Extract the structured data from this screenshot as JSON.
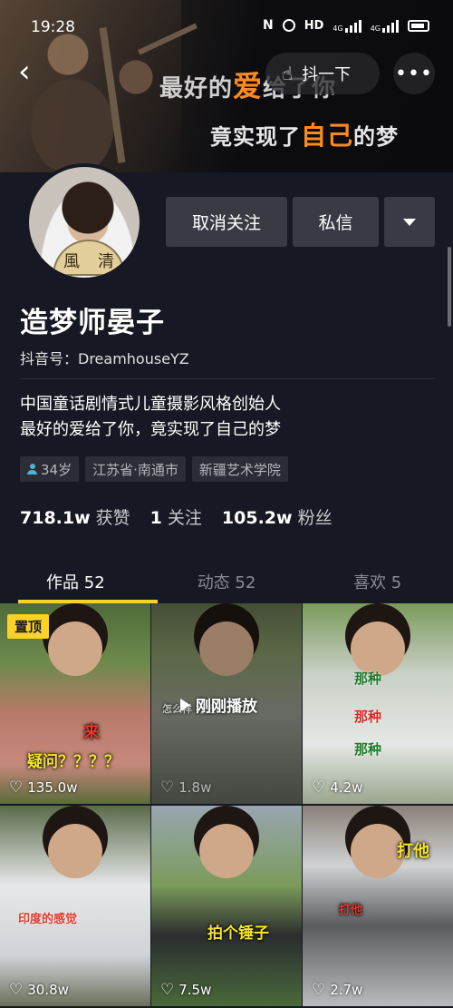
{
  "status_bar": {
    "time": "19:28",
    "icons": [
      "nfc-icon",
      "alarm-icon",
      "hd-icon",
      "signal-4g-icon",
      "signal-4g-icon",
      "battery-icon"
    ],
    "hd": "HD",
    "net1": "4G",
    "net2": "4G"
  },
  "cover": {
    "line1_pre": "最好的",
    "line1_hl": "爱",
    "line1_post": "给了你",
    "line2_pre": "竟实现了",
    "line2_hl": "自己",
    "line2_post": "的梦",
    "highlight_color": "#ff8a1f"
  },
  "header": {
    "shake_label": "抖一下",
    "more_label": "•••"
  },
  "profile": {
    "avatar_text": [
      "風",
      "清"
    ],
    "unfollow_label": "取消关注",
    "message_label": "私信",
    "name": "造梦师晏子",
    "douyin_id": "抖音号：DreamhouseYZ",
    "bio_line1": "中国童话剧情式儿童摄影风格创始人",
    "bio_line2": "最好的爱给了你，竟实现了自己的梦",
    "tags": {
      "age": "34岁",
      "location": "江苏省·南通市",
      "school": "新疆艺术学院"
    },
    "stats": {
      "likes_num": "718.1w",
      "likes_label": "获赞",
      "following_num": "1",
      "following_label": "关注",
      "fans_num": "105.2w",
      "fans_label": "粉丝"
    }
  },
  "tabs": {
    "works": "作品 52",
    "dynamics": "动态 52",
    "likes": "喜欢 5"
  },
  "videos": [
    {
      "pinned": "置顶",
      "likes": "135.0w",
      "cap1": "来",
      "cap2": "疑问？？？？"
    },
    {
      "playing": "刚刚播放",
      "likes": "1.8w",
      "cap1": "怎么样 打造出 一个"
    },
    {
      "likes": "4.2w",
      "cap1": "那种",
      "cap2": "那种",
      "cap3": "那种"
    },
    {
      "likes": "30.8w",
      "cap1": "印度的感觉"
    },
    {
      "likes": "7.5w",
      "cap1": "拍个锤子"
    },
    {
      "likes": "2.7w",
      "cap1": "打他",
      "cap2": "打他"
    }
  ]
}
